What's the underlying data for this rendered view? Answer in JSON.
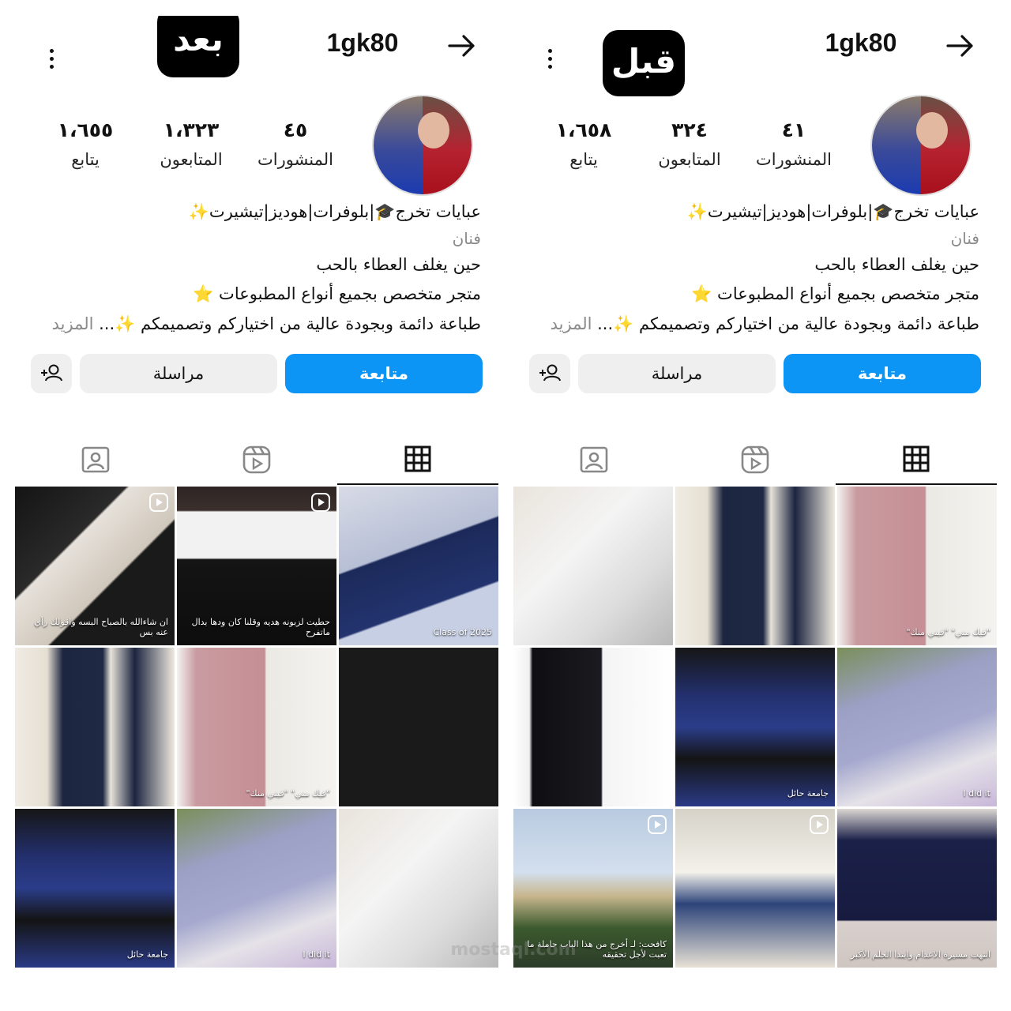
{
  "panels": {
    "after": {
      "tag": "بعد",
      "username": "1gk80",
      "stats": {
        "posts": "٤٥",
        "followers": "١،٣٢٣",
        "following": "١،٦٥٥"
      },
      "labels": {
        "posts": "المنشورات",
        "followers": "المتابعون",
        "following": "يتابع"
      },
      "bio": {
        "title": "عبايات تخرج🎓|بلوفرات|هوديز|تيشيرت✨",
        "category": "فنان",
        "line1": "حين يغلف العطاء بالحب",
        "line2": "متجر متخصص بجميع أنواع المطبوعات ⭐",
        "line3": "طباعة دائمة وبجودة عالية من اختياركم وتصميمكم ✨...",
        "more": " المزيد"
      },
      "buttons": {
        "follow": "متابعة",
        "message": "مراسلة"
      },
      "posts": [
        {
          "theme": "grad-cap-navy",
          "text": "Class of 2025"
        },
        {
          "theme": "tweet-screenshot",
          "text": "حطيت لزبونه هديه وقلنا كان ودها بدال ماتفرح",
          "reel": true
        },
        {
          "theme": "dark-reel",
          "text": "ان شاءالله بالصباح البسه واقولك رأي عنه بس",
          "reel": true
        },
        {
          "theme": "vest-white-brown",
          "text": ""
        },
        {
          "theme": "hoodies-pink-white",
          "text": "\"فيك مني\" \"فيني منك\""
        },
        {
          "theme": "stoles-navy",
          "text": ""
        },
        {
          "theme": "hooded-person",
          "text": ""
        },
        {
          "theme": "cap-flowers",
          "text": "I did it"
        },
        {
          "theme": "gown-blue-hood",
          "text": "جامعة حائل"
        }
      ]
    },
    "before": {
      "tag": "قبل",
      "username": "1gk80",
      "stats": {
        "posts": "٤١",
        "followers": "٣٢٤",
        "following": "١،٦٥٨"
      },
      "labels": {
        "posts": "المنشورات",
        "followers": "المتابعون",
        "following": "يتابع"
      },
      "bio": {
        "title": "عبايات تخرج🎓|بلوفرات|هوديز|تيشيرت✨",
        "category": "فنان",
        "line1": "حين يغلف العطاء بالحب",
        "line2": "متجر متخصص بجميع أنواع المطبوعات ⭐",
        "line3": "طباعة دائمة وبجودة عالية من اختياركم وتصميمكم ✨...",
        "more": " المزيد"
      },
      "buttons": {
        "follow": "متابعة",
        "message": "مراسلة"
      },
      "posts": [
        {
          "theme": "hoodies-pink-white",
          "text": "\"فيك مني\" \"فيني منك\""
        },
        {
          "theme": "stoles-navy",
          "text": ""
        },
        {
          "theme": "hooded-person",
          "text": ""
        },
        {
          "theme": "cap-flowers",
          "text": "I did it"
        },
        {
          "theme": "gown-blue-hood",
          "text": "جامعة حائل"
        },
        {
          "theme": "tshirts",
          "text": ""
        },
        {
          "theme": "hood-navy-gold",
          "text": "انتهت مسيرة الاعدام وابتدا الحلم الأكبر"
        },
        {
          "theme": "person-sitting",
          "text": "",
          "reel": true
        },
        {
          "theme": "street-sign",
          "text": "كافحت: لـ أخرج من هذا الباب حاملة ما تعبت لأجل تحقيقه",
          "reel": true
        }
      ]
    }
  },
  "watermark": "mostaql.com",
  "colors": {
    "follow": "#0d95f6",
    "secondary": "#efefef"
  }
}
